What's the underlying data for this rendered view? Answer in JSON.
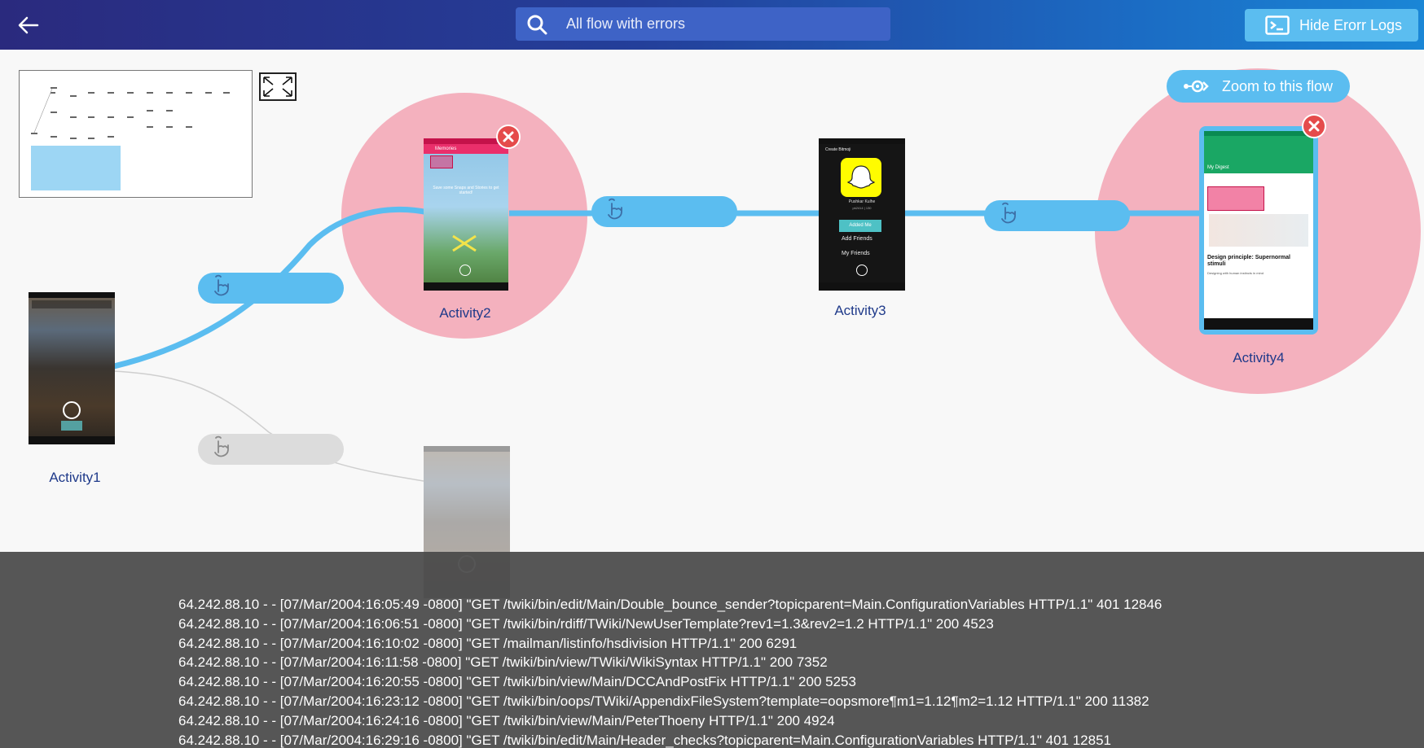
{
  "header": {
    "search_placeholder": "All flow with errors",
    "hide_logs_label": "Hide Erorr Logs"
  },
  "canvas": {
    "zoom_to_flow_label": "Zoom to this flow",
    "nodes": [
      {
        "label": "Activity1"
      },
      {
        "label": "Activity2"
      },
      {
        "label": "Activity3"
      },
      {
        "label": "Activity4"
      }
    ],
    "screen_texts": {
      "activity2_title": "Memories",
      "activity2_message": "Save some Snaps and Stories to get started!",
      "activity3_header": "Create Bitmoji",
      "activity3_name": "Pushkar Kulhe",
      "activity3_score": "pk2414 | 130",
      "activity3_added_me": "Added Me",
      "activity3_add_friends": "Add Friends",
      "activity3_my_friends": "My Friends",
      "activity4_header": "My Digest",
      "activity4_article_title": "Design principle: Supernormal stimuli",
      "activity4_article_sub": "Designing with human instincts in mind"
    },
    "colors": {
      "highlight_circle": "#f4b1be",
      "edge_active": "#5bbdf0",
      "edge_inactive": "#cfcfcf",
      "error_badge": "#e54b4b",
      "label": "#1f3a8a"
    }
  },
  "logs": [
    "64.242.88.10 - - [07/Mar/2004:16:05:49 -0800] \"GET /twiki/bin/edit/Main/Double_bounce_sender?topicparent=Main.ConfigurationVariables HTTP/1.1\" 401 12846",
    "64.242.88.10 - - [07/Mar/2004:16:06:51 -0800] \"GET /twiki/bin/rdiff/TWiki/NewUserTemplate?rev1=1.3&rev2=1.2 HTTP/1.1\" 200 4523",
    "64.242.88.10 - - [07/Mar/2004:16:10:02 -0800] \"GET /mailman/listinfo/hsdivision HTTP/1.1\" 200 6291",
    "64.242.88.10 - - [07/Mar/2004:16:11:58 -0800] \"GET /twiki/bin/view/TWiki/WikiSyntax HTTP/1.1\" 200 7352",
    "64.242.88.10 - - [07/Mar/2004:16:20:55 -0800] \"GET /twiki/bin/view/Main/DCCAndPostFix HTTP/1.1\" 200 5253",
    "64.242.88.10 - - [07/Mar/2004:16:23:12 -0800] \"GET /twiki/bin/oops/TWiki/AppendixFileSystem?template=oopsmore¶m1=1.12¶m2=1.12 HTTP/1.1\" 200 11382",
    "64.242.88.10 - - [07/Mar/2004:16:24:16 -0800] \"GET /twiki/bin/view/Main/PeterThoeny HTTP/1.1\" 200 4924",
    "64.242.88.10 - - [07/Mar/2004:16:29:16 -0800] \"GET /twiki/bin/edit/Main/Header_checks?topicparent=Main.ConfigurationVariables HTTP/1.1\" 401 12851"
  ]
}
